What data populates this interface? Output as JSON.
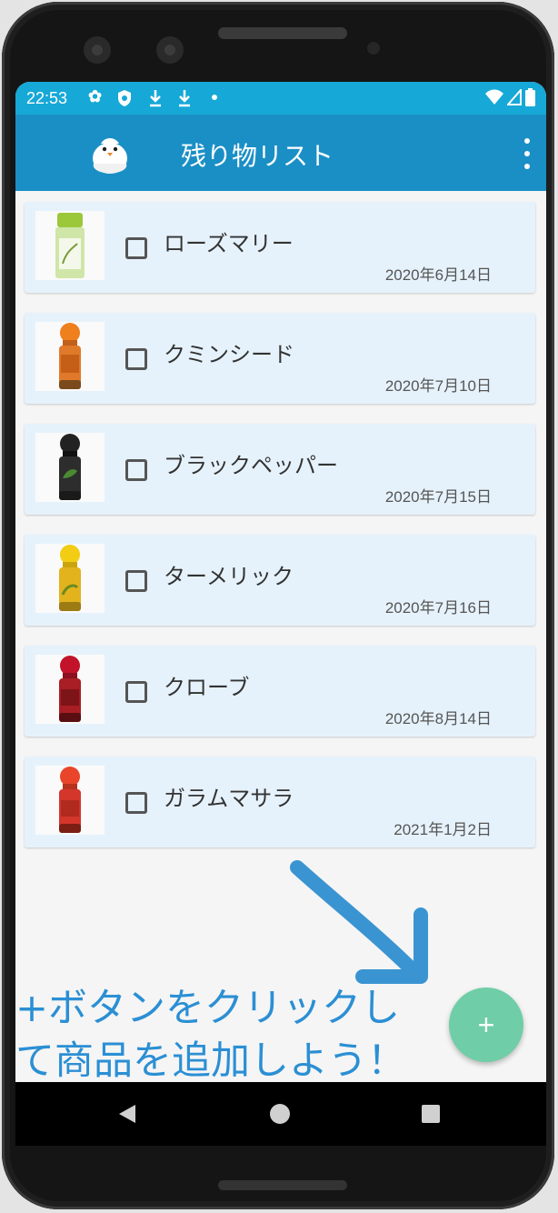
{
  "status_bar": {
    "time": "22:53",
    "left_icons": [
      "gear-icon",
      "shield-icon",
      "download-icon",
      "download-icon",
      "dot-icon"
    ],
    "right_icons": [
      "wifi-icon",
      "signal-icon",
      "battery-icon"
    ]
  },
  "app_bar": {
    "title": "残り物リスト",
    "logo_icon": "bird-icon",
    "menu_icon": "more-vert-icon"
  },
  "items": [
    {
      "name": "ローズマリー",
      "date": "2020年6月14日",
      "checked": false,
      "cap_color": "#9bc83b",
      "label_color": "#cfe6a8"
    },
    {
      "name": "クミンシード",
      "date": "2020年7月10日",
      "checked": false,
      "cap_color": "#f07f1e",
      "label_color": "#e07a2a"
    },
    {
      "name": "ブラックペッパー",
      "date": "2020年7月15日",
      "checked": false,
      "cap_color": "#222222",
      "label_color": "#2d2d2d"
    },
    {
      "name": "ターメリック",
      "date": "2020年7月16日",
      "checked": false,
      "cap_color": "#f2cd14",
      "label_color": "#e3b31d"
    },
    {
      "name": "クローブ",
      "date": "2020年8月14日",
      "checked": false,
      "cap_color": "#c2132b",
      "label_color": "#a81e24"
    },
    {
      "name": "ガラムマサラ",
      "date": "2021年1月2日",
      "checked": false,
      "cap_color": "#e8452a",
      "label_color": "#d4362b"
    }
  ],
  "fab": {
    "label": "+",
    "color": "#6fcea7"
  },
  "annotation": {
    "line1": "+ボタンをクリックし",
    "line2": "て商品を追加しよう！",
    "color": "#2b8fd4"
  },
  "nav_bar": {
    "icons": [
      "back-icon",
      "home-icon",
      "recents-icon"
    ]
  },
  "colors": {
    "status_bar": "#16a8d7",
    "app_bar": "#1a8fc6",
    "card": "#e6f2fb"
  }
}
